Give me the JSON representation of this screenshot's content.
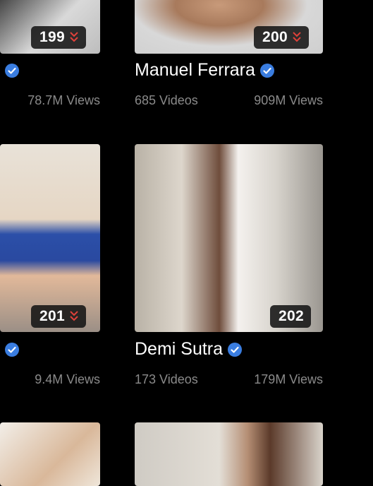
{
  "colors": {
    "background": "#000000",
    "badge_bg": "#141414",
    "chevron": "#e0413a",
    "verified": "#3a7de0",
    "stat_text": "#8a8a8a"
  },
  "cards": {
    "left_top": {
      "rank": "199",
      "views": "78.7M Views"
    },
    "right_top": {
      "rank": "200",
      "name": "Manuel Ferrara",
      "videos": "685 Videos",
      "views": "909M Views"
    },
    "left_mid": {
      "rank": "201",
      "views": "9.4M Views"
    },
    "right_mid": {
      "rank": "202",
      "name": "Demi Sutra",
      "videos": "173 Videos",
      "views": "179M Views"
    }
  },
  "icons": {
    "rank_down": "double-chevron-down-icon",
    "verified": "verified-check-icon"
  }
}
